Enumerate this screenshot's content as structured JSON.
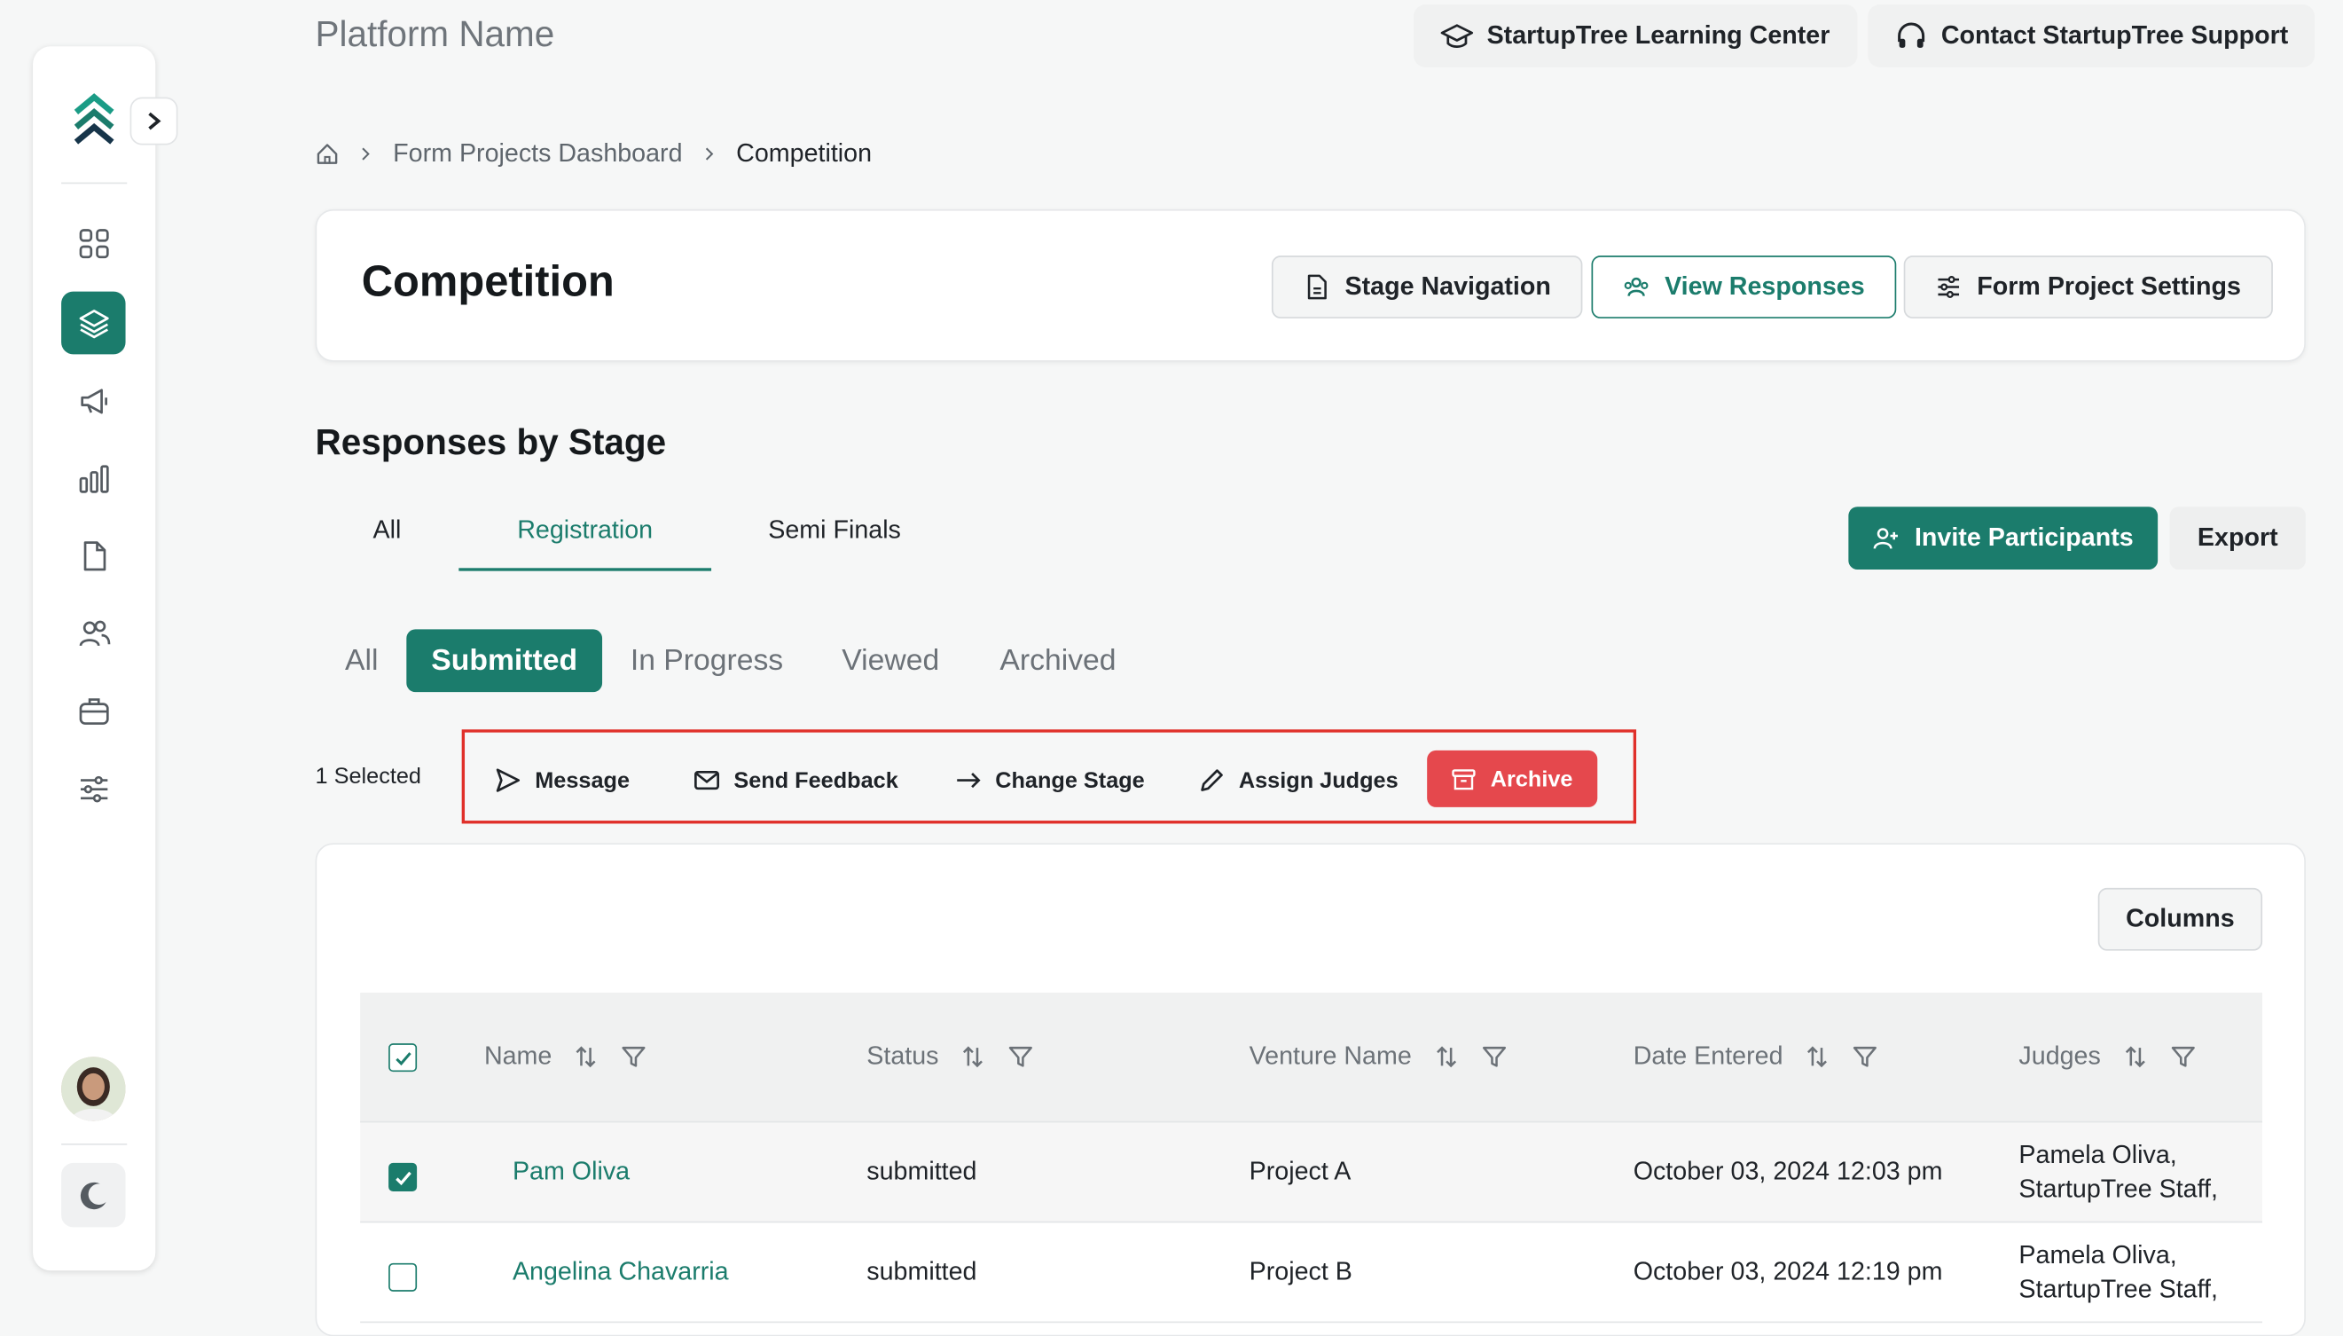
{
  "header": {
    "platform_name": "Platform Name",
    "learning_center_label": "StartupTree Learning Center",
    "support_label": "Contact StartupTree Support"
  },
  "breadcrumb": {
    "parent": "Form Projects Dashboard",
    "current": "Competition"
  },
  "project": {
    "title": "Competition",
    "stage_nav_label": "Stage Navigation",
    "view_responses_label": "View Responses",
    "settings_label": "Form Project Settings"
  },
  "responses": {
    "section_title": "Responses by Stage",
    "stage_tabs": [
      "All",
      "Registration",
      "Semi Finals"
    ],
    "active_stage": "Registration",
    "invite_label": "Invite Participants",
    "export_label": "Export",
    "status_tabs": [
      "All",
      "Submitted",
      "In Progress",
      "Viewed",
      "Archived"
    ],
    "active_status": "Submitted"
  },
  "bulk_actions": {
    "selected_text": "1 Selected",
    "message": "Message",
    "send_feedback": "Send Feedback",
    "change_stage": "Change Stage",
    "assign_judges": "Assign Judges",
    "archive": "Archive"
  },
  "table": {
    "columns_label": "Columns",
    "headers": [
      "Name",
      "Status",
      "Venture Name",
      "Date Entered",
      "Judges"
    ],
    "header_checkbox_checked": true,
    "rows": [
      {
        "checked": true,
        "name": "Pam Oliva",
        "status": "submitted",
        "venture": "Project A",
        "date": "October 03, 2024 12:03 pm",
        "judges": "Pamela Oliva, StartupTree Staff, Hulda Zheng"
      },
      {
        "checked": false,
        "name": "Angelina Chavarria",
        "status": "submitted",
        "venture": "Project B",
        "date": "October 03, 2024 12:19 pm",
        "judges": "Pamela Oliva, StartupTree Staff, Hulda Zheng"
      }
    ]
  },
  "colors": {
    "brand": "#1b7c6c",
    "danger": "#e5484d",
    "highlight_border": "#e0302a"
  },
  "icons": {
    "sidebar": [
      "dashboard-icon",
      "layers-icon",
      "megaphone-icon",
      "bar-chart-icon",
      "document-icon",
      "users-icon",
      "briefcase-icon",
      "sliders-icon"
    ]
  }
}
